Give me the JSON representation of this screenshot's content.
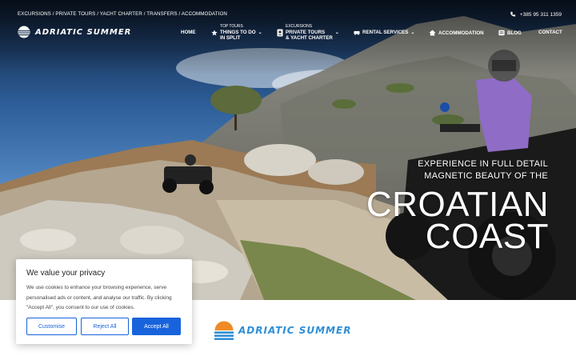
{
  "topbar": {
    "links": "EXCURSIONS / PRIVATE TOURS / YACHT CHARTER / TRANSFERS / ACCOMMODATION",
    "phone": "+385 95 311 1359"
  },
  "brand": {
    "name": "ADRIATIC SUMMER"
  },
  "nav": {
    "home": "HOME",
    "top_tours_sub": "TOP TOURS",
    "top_tours_line1": "THINGS TO DO",
    "top_tours_line2": "IN SPLIT",
    "excursions_sub": "EXCURSIONS",
    "excursions_line1": "PRIVATE TOURS",
    "excursions_line2": "& YACHT CHARTER",
    "rental": "RENTAL SERVICES",
    "accommodation": "ACCOMMODATION",
    "blog": "BLOG",
    "contact": "CONTACT"
  },
  "hero": {
    "line1": "EXPERIENCE IN FULL DETAIL",
    "line2": "MAGNETIC BEAUTY OF THE",
    "big1": "CROATIAN",
    "big2": "COAST"
  },
  "cookie": {
    "title": "We value your privacy",
    "text": "We use cookies to enhance your browsing experience, serve personalised ads or content, and analyse our traffic. By clicking \"Accept All\", you consent to our use of cookies.",
    "customise": "Customise",
    "reject": "Reject All",
    "accept": "Accept All"
  },
  "colors": {
    "accent": "#1863dc",
    "logo_blue": "#2f8fd6",
    "logo_orange": "#f08a24"
  },
  "icons": [
    "phone-icon",
    "star-icon",
    "passport-icon",
    "car-icon",
    "home-icon",
    "blog-icon",
    "chevron-down-icon"
  ]
}
